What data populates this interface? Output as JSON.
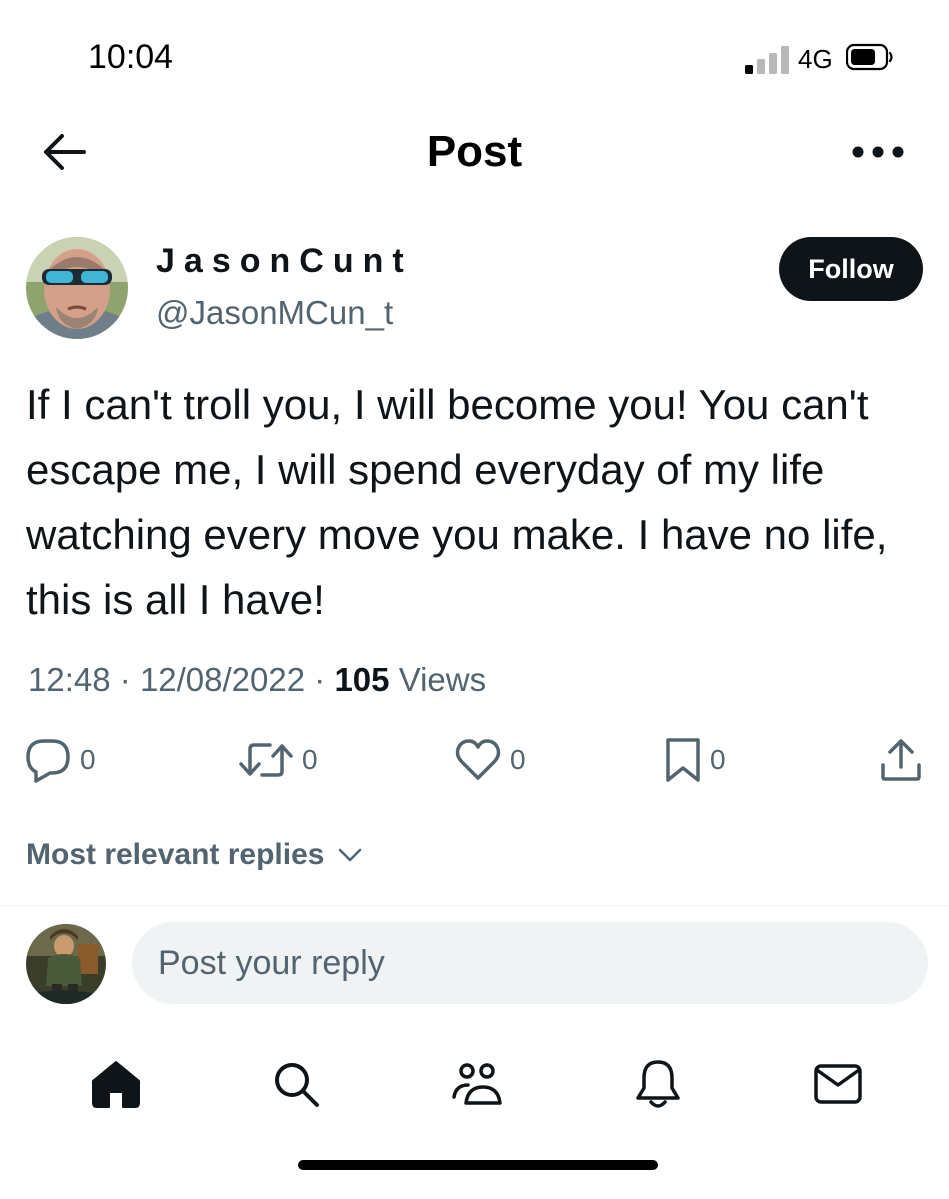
{
  "status_bar": {
    "time": "10:04",
    "network": "4G",
    "icons": [
      "signal-icon",
      "battery-icon"
    ]
  },
  "header": {
    "title": "Post",
    "icons": [
      "back-arrow-icon",
      "more-icon"
    ]
  },
  "author": {
    "display_name": "JasonCunt",
    "handle": "@JasonMCun_t",
    "follow_label": "Follow"
  },
  "post": {
    "text": "If I can't troll you, I will become you! You can't escape me, I will spend everyday of my life watching every move you make. I have no life, this is all I have!",
    "time": "12:48",
    "separator": "·",
    "date": "12/08/2022",
    "views_count": "105",
    "views_label": "Views"
  },
  "actions": {
    "reply_count": "0",
    "repost_count": "0",
    "like_count": "0",
    "bookmark_count": "0",
    "icons": [
      "reply-icon",
      "repost-icon",
      "like-icon",
      "bookmark-icon",
      "share-icon"
    ]
  },
  "replies": {
    "sort_label": "Most relevant replies",
    "input_placeholder": "Post your reply"
  },
  "tab_bar": {
    "icons": [
      "home-icon",
      "search-icon",
      "communities-icon",
      "notifications-icon",
      "messages-icon"
    ]
  },
  "colors": {
    "text_primary": "#0f1419",
    "text_secondary": "#536471",
    "follow_bg": "#0f1419",
    "input_bg": "#eff3f4",
    "divider": "#eff3f4"
  }
}
